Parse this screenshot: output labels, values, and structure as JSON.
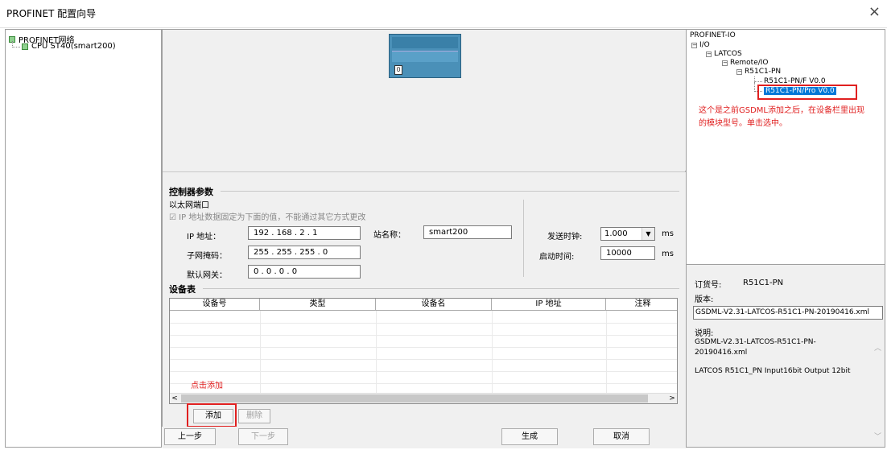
{
  "window": {
    "title": "PROFINET 配置向导",
    "close_glyph": "×"
  },
  "left_tree": {
    "root": "PROFINET网络",
    "child": "CPU ST40(smart200)"
  },
  "plc_graphic": {
    "port_label": "0"
  },
  "controller": {
    "section_title": "控制器参数",
    "eth_port_label": "以太网端口",
    "fixed_ip_checkbox_label": "IP 地址数据固定为下面的值，不能通过其它方式更改",
    "ip_label": "IP 地址：",
    "ip_value": "192 . 168 . 2 . 1",
    "subnet_label": "子网掩码：",
    "subnet_value": "255 . 255 . 255 . 0",
    "gateway_label": "默认网关：",
    "gateway_value": "0 . 0 . 0 . 0",
    "station_label": "站名称：",
    "station_value": "smart200",
    "send_clock_label": "发送时钟:",
    "send_clock_value": "1.000",
    "send_clock_unit": "ms",
    "startup_label": "启动时间:",
    "startup_value": "10000",
    "startup_unit": "ms"
  },
  "device_table": {
    "section_title": "设备表",
    "columns": [
      "设备号",
      "类型",
      "设备名",
      "IP 地址",
      "注释"
    ],
    "annotation": "点击添加",
    "scroll_left": "<",
    "scroll_right": ">"
  },
  "buttons": {
    "add": "添加",
    "delete": "删除",
    "prev": "上一步",
    "next": "下一步",
    "generate": "生成",
    "cancel": "取消"
  },
  "right_tree": {
    "root": "PROFINET-IO",
    "io": "I/O",
    "vendor": "LATCOS",
    "remote": "Remote/IO",
    "device": "R51C1-PN",
    "module_f": "R51C1-PN/F V0.0",
    "module_pro": "R51C1-PN/Pro V0.0",
    "annotation": "这个是之前GSDML添加之后，在设备栏里出现的模块型号。单击选中。"
  },
  "info": {
    "order_label": "订货号:",
    "order_value": "R51C1-PN",
    "version_label": "版本:",
    "version_value": "GSDML-V2.31-LATCOS-R51C1-PN-20190416.xml",
    "desc_label": "说明:",
    "desc_file": "GSDML-V2.31-LATCOS-R51C1-PN-20190416.xml",
    "desc_text": "LATCOS R51C1_PN Input16bit Output 12bit"
  },
  "colors": {
    "accent_red": "#e02020",
    "selection_blue": "#0078d7",
    "tree_green": "#8fd08f"
  }
}
